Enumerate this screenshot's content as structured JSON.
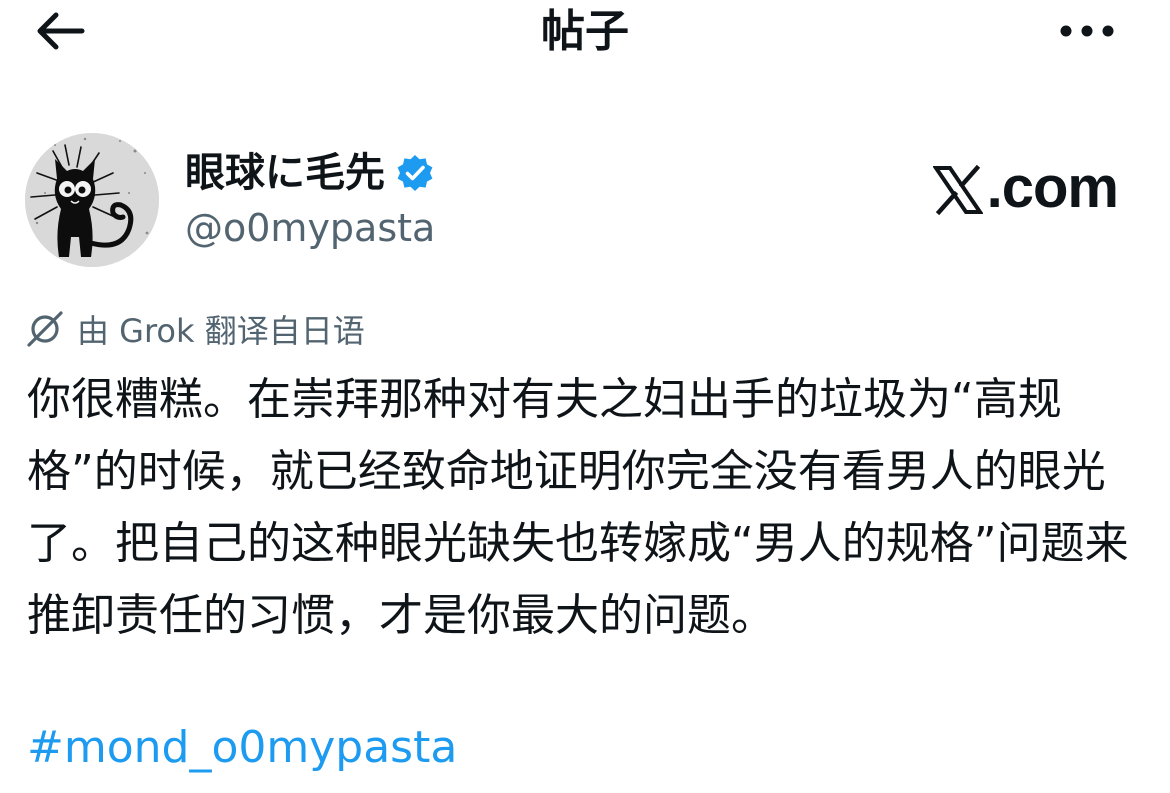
{
  "header": {
    "title": "帖子",
    "back_icon": "arrow-left-icon",
    "more_icon": "more-horizontal-icon"
  },
  "author": {
    "display_name": "眼球に毛先",
    "handle": "@o0mypasta",
    "verified": true,
    "verified_color": "#1d9bf0",
    "avatar_icon": "black-cat-avatar"
  },
  "watermark": {
    "text": ".com",
    "icon": "x-logo-icon"
  },
  "translation": {
    "label": "由 Grok 翻译自日语",
    "icon": "grok-icon"
  },
  "post": {
    "text": "你很糟糕。在崇拜那种对有夫之妇出手的垃圾为“高规格”的时候，就已经致命地证明你完全没有看男人的眼光了。把自己的这种眼光缺失也转嫁成“男人的规格”问题来推卸责任的习惯，才是你最大的问题。",
    "hashtag": "#mond_o0mypasta"
  },
  "colors": {
    "text_primary": "#0f1419",
    "text_secondary": "#536471",
    "accent": "#1d9bf0"
  }
}
